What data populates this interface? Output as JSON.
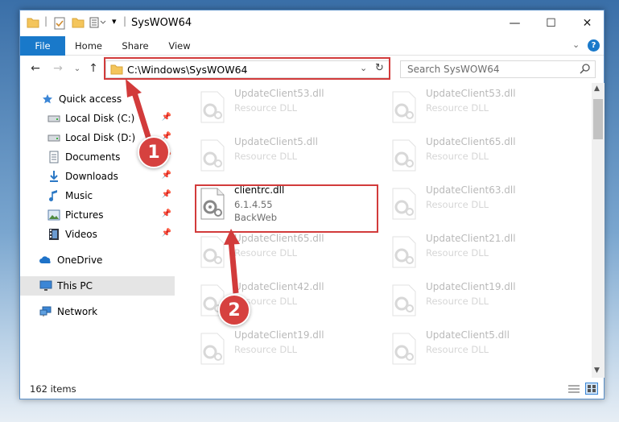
{
  "window": {
    "title": "SysWOW64",
    "controls": {
      "minimize": "—",
      "maximize": "☐",
      "close": "✕"
    }
  },
  "ribbon": {
    "tabs": [
      "File",
      "Home",
      "Share",
      "View"
    ],
    "help": "?"
  },
  "address_bar": {
    "path": "C:\\Windows\\SysWOW64",
    "search_placeholder": "Search SysWOW64"
  },
  "nav_pane": {
    "items": [
      {
        "label": "Quick access",
        "icon": "star-icon"
      },
      {
        "label": "Local Disk (C:)",
        "icon": "drive-icon",
        "pinned": true
      },
      {
        "label": "Local Disk (D:)",
        "icon": "drive-icon",
        "pinned": true
      },
      {
        "label": "Documents",
        "icon": "documents-icon",
        "pinned": true
      },
      {
        "label": "Downloads",
        "icon": "downloads-icon",
        "pinned": true
      },
      {
        "label": "Music",
        "icon": "music-icon",
        "pinned": true
      },
      {
        "label": "Pictures",
        "icon": "pictures-icon",
        "pinned": true
      },
      {
        "label": "Videos",
        "icon": "videos-icon",
        "pinned": true
      },
      {
        "label": "OneDrive",
        "icon": "onedrive-icon"
      },
      {
        "label": "This PC",
        "icon": "this-pc-icon",
        "selected": true
      },
      {
        "label": "Network",
        "icon": "network-icon"
      }
    ]
  },
  "files": {
    "left_column": [
      {
        "name": "UpdateClient53.dll",
        "type": "Resource DLL"
      },
      {
        "name": "UpdateClient5.dll",
        "type": "Resource DLL"
      },
      {
        "name": "clientrc.dll",
        "version": "6.1.4.55",
        "company": "BackWeb",
        "highlighted": true
      },
      {
        "name": "UpdateClient65.dll",
        "type": "Resource DLL"
      },
      {
        "name": "UpdateClient42.dll",
        "type": "Resource DLL"
      },
      {
        "name": "UpdateClient19.dll",
        "type": "Resource DLL"
      }
    ],
    "right_column": [
      {
        "name": "UpdateClient53.dll",
        "type": "Resource DLL"
      },
      {
        "name": "UpdateClient65.dll",
        "type": "Resource DLL"
      },
      {
        "name": "UpdateClient63.dll",
        "type": "Resource DLL"
      },
      {
        "name": "UpdateClient21.dll",
        "type": "Resource DLL"
      },
      {
        "name": "UpdateClient19.dll",
        "type": "Resource DLL"
      },
      {
        "name": "UpdateClient5.dll",
        "type": "Resource DLL"
      }
    ]
  },
  "status_bar": {
    "item_count": "162 items"
  },
  "annotations": {
    "step1": "1",
    "step2": "2"
  },
  "colors": {
    "accent": "#1979ca",
    "annotation_red": "#d23b3b",
    "selected_nav": "#e5e5e5"
  }
}
